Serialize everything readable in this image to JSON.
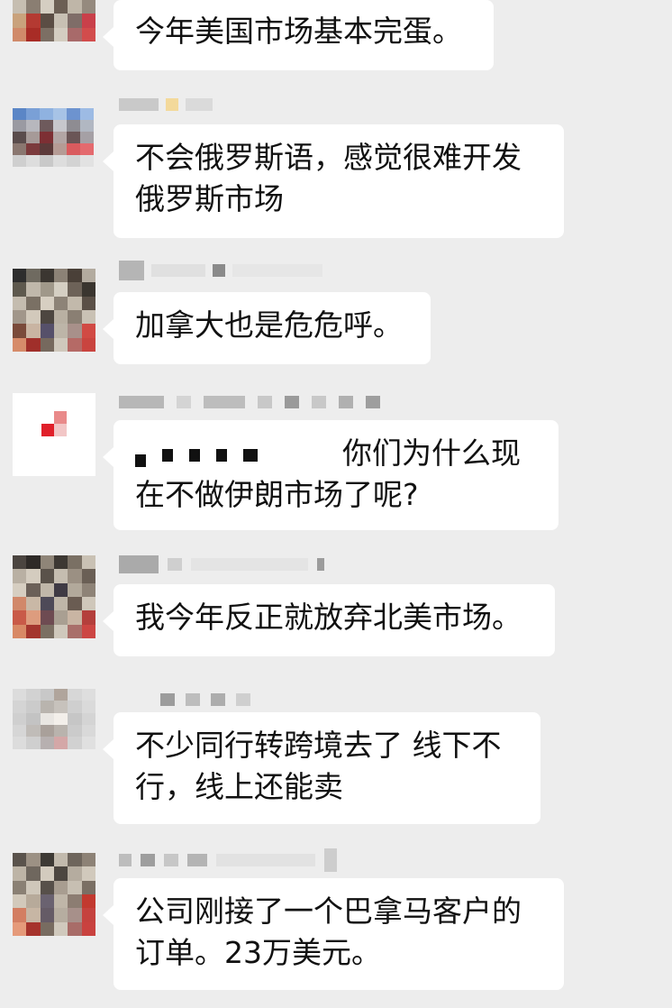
{
  "messages": [
    {
      "lines": [
        "今年美国市场基本完蛋。"
      ]
    },
    {
      "lines": [
        "不会俄罗斯语，感觉很难开发",
        "俄罗斯市场"
      ]
    },
    {
      "lines": [
        "加拿大也是危危呼。"
      ]
    },
    {
      "lines": [
        "你们为什么现",
        "在不做伊朗市场了呢?"
      ]
    },
    {
      "lines": [
        "我今年反正就放弃北美市场。"
      ]
    },
    {
      "lines": [
        "不少同行转跨境去了 线下不",
        "行，线上还能卖"
      ]
    },
    {
      "lines": [
        "公司刚接了一个巴拿马客户的",
        "订单。23万美元。"
      ]
    }
  ],
  "colors": {
    "background": "#ededed",
    "bubble": "#ffffff",
    "text": "#111111"
  }
}
